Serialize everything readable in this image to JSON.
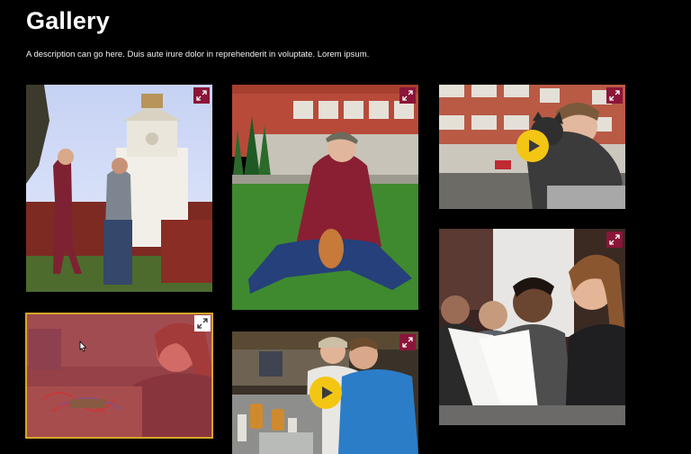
{
  "page": {
    "title": "Gallery",
    "description": "A description can go here. Duis aute irure dolor in reprehenderit in voluptate. Lorem ipsum."
  },
  "colors": {
    "accent_maroon": "#8a1538",
    "play_yellow": "#f3c614",
    "selected_overlay": "#c63a48",
    "selected_border": "#d7a628",
    "background": "#000000"
  },
  "gallery": {
    "items": [
      {
        "name": "campus-clock-tower-students-photo",
        "media": "photo",
        "icon": "expand-icon"
      },
      {
        "name": "student-with-dog-on-lawn-photo",
        "media": "photo",
        "icon": "expand-icon"
      },
      {
        "name": "student-holding-cat-video",
        "media": "video",
        "icon": "expand-icon",
        "play_icon": "play-icon"
      },
      {
        "name": "students-in-class-with-papers-photo",
        "media": "photo",
        "icon": "expand-icon"
      },
      {
        "name": "student-in-lab-photo",
        "media": "photo",
        "icon": "expand-icon",
        "state": "hovered"
      },
      {
        "name": "students-in-chemistry-lab-video",
        "media": "video",
        "icon": "expand-icon",
        "play_icon": "play-icon"
      }
    ]
  }
}
